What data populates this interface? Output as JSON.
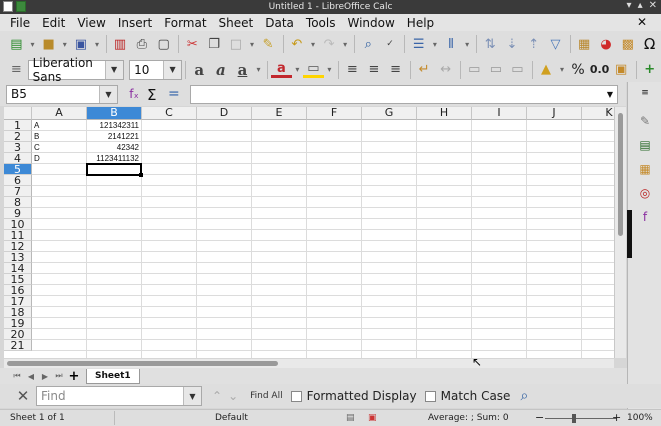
{
  "window": {
    "title": "Untitled 1 - LibreOffice Calc"
  },
  "menu": [
    "File",
    "Edit",
    "View",
    "Insert",
    "Format",
    "Sheet",
    "Data",
    "Tools",
    "Window",
    "Help"
  ],
  "toolbar": {
    "font_name": "Liberation Sans",
    "font_size": "10"
  },
  "formula_bar": {
    "name_box": "B5",
    "content": ""
  },
  "grid": {
    "columns": [
      "A",
      "B",
      "C",
      "D",
      "E",
      "F",
      "G",
      "H",
      "I",
      "J",
      "K"
    ],
    "rows": [
      "1",
      "2",
      "3",
      "4",
      "5",
      "6",
      "7",
      "8",
      "9",
      "10",
      "11",
      "12",
      "13",
      "14",
      "15",
      "16",
      "17",
      "18",
      "19",
      "20",
      "21"
    ],
    "selected_cell": "B5",
    "cells": {
      "A1": "A",
      "B1": "121342311",
      "A2": "B",
      "B2": "2141221",
      "A3": "C",
      "B3": "42342",
      "A4": "D",
      "B4": "1123411132"
    }
  },
  "sheet_tab": {
    "active": "Sheet1"
  },
  "find": {
    "placeholder": "Find",
    "find_all": "Find All",
    "formatted_display": "Formatted Display",
    "match_case": "Match Case"
  },
  "status": {
    "sheet": "Sheet 1 of 1",
    "page_style": "Default",
    "summary": "Average: ; Sum: 0",
    "zoom": "100%"
  },
  "colors": {
    "selection": "#3d89d6",
    "grid_line": "#dcdcdc"
  }
}
